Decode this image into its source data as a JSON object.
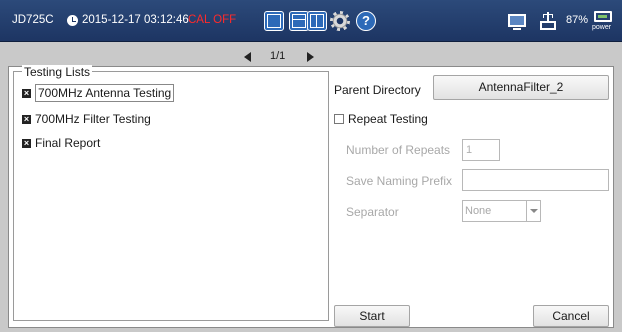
{
  "titlebar": {
    "model": "JD725C",
    "datetime": "2015-12-17 03:12:46",
    "cal_status": "CAL OFF",
    "battery": "87%",
    "power_label": "power",
    "cal_color": "#ff2a2a"
  },
  "pager": {
    "text": "1/1"
  },
  "testing_lists": {
    "title": "Testing Lists",
    "items": [
      {
        "label": "700MHz Antenna Testing"
      },
      {
        "label": "700MHz Filter Testing"
      },
      {
        "label": "Final Report"
      }
    ]
  },
  "settings": {
    "parent_directory_label": "Parent Directory",
    "parent_directory_value": "AntennaFilter_2",
    "repeat_testing_label": "Repeat Testing",
    "number_of_repeats_label": "Number of Repeats",
    "number_of_repeats_value": "1",
    "save_naming_prefix_label": "Save Naming Prefix",
    "save_naming_prefix_value": "",
    "separator_label": "Separator",
    "separator_value": "None"
  },
  "actions": {
    "start": "Start",
    "cancel": "Cancel"
  },
  "icons": {
    "clock": "clock-icon",
    "layout_single": "layout-single-icon",
    "layout_hsplit": "layout-hsplit-icon",
    "layout_vsplit": "layout-vsplit-icon",
    "settings": "gear-icon",
    "help": "help-icon",
    "monitor": "monitor-icon",
    "usb": "usb-icon",
    "power": "power-plug-icon"
  }
}
